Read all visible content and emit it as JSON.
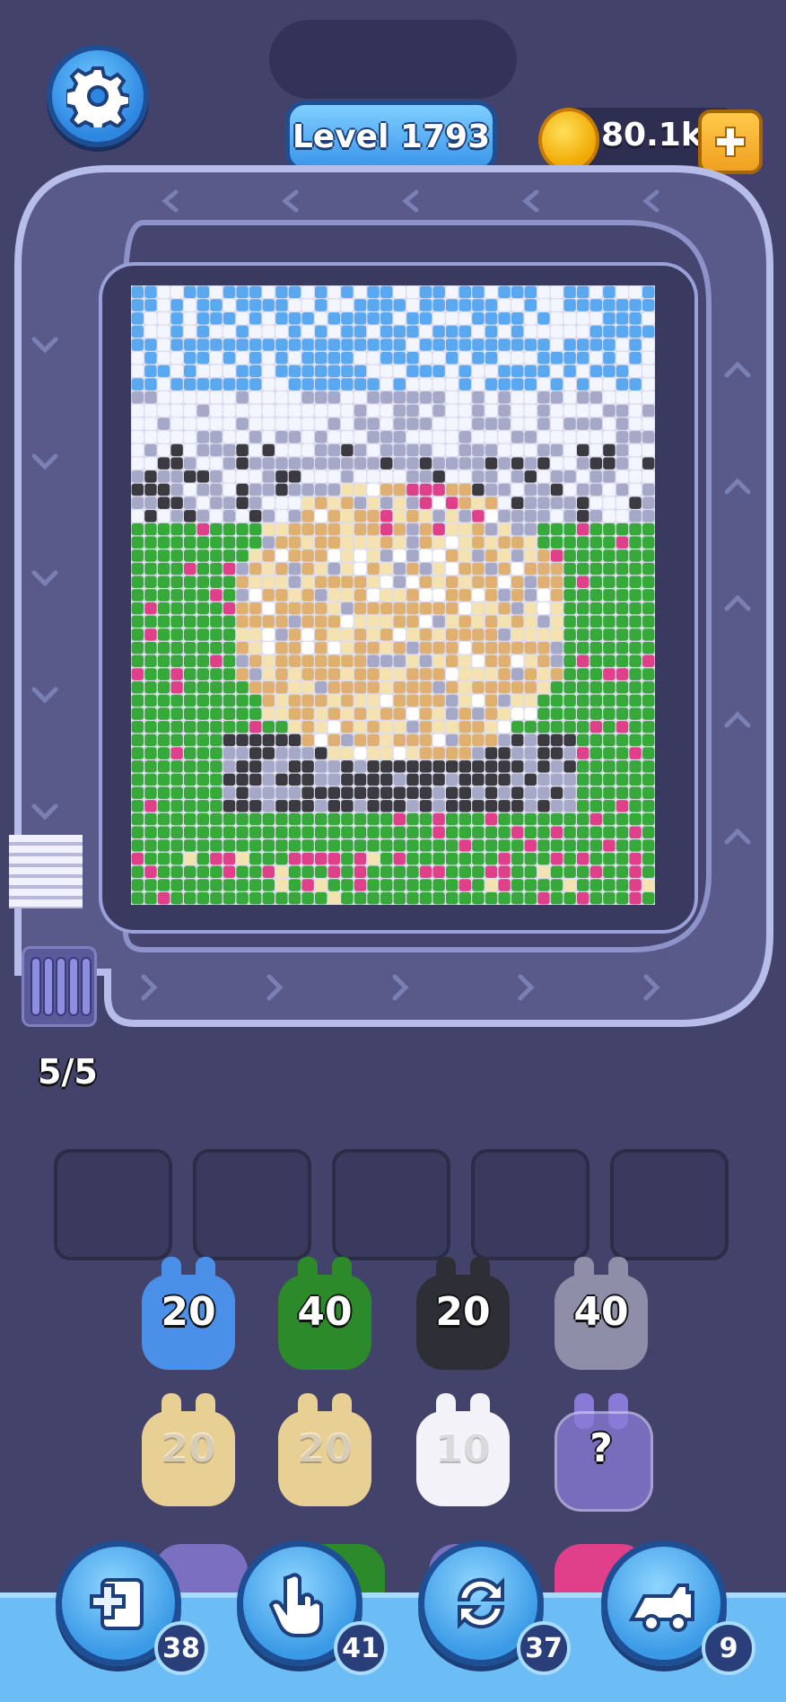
{
  "header": {
    "level_label": "Level 1793",
    "coins": "80.1k"
  },
  "queue": {
    "counter": "5/5"
  },
  "slots": [
    {},
    {},
    {},
    {},
    {}
  ],
  "colors": {
    "sky": "#5aa8f0",
    "cloud": "#f4f6ff",
    "mountain": "#a6a8c8",
    "dark": "#3a3a40",
    "grass": "#37a83a",
    "cream": "#f4e3b0",
    "tan": "#e0b070",
    "white": "#ffffff",
    "pink": "#e0408a",
    "blue_piece": "#4a8fe8",
    "green_piece": "#2c8a2a",
    "black_piece": "#2e2e36",
    "gray_piece": "#8e8ea8",
    "mystery_piece": "#8a7ad8"
  },
  "pieces": [
    {
      "name": "blue-piece",
      "color": "#4a8fe8",
      "count": "20"
    },
    {
      "name": "green-piece",
      "color": "#2c8a2a",
      "count": "40"
    },
    {
      "name": "black-piece",
      "color": "#2e2e36",
      "count": "20"
    },
    {
      "name": "gray-piece",
      "color": "#8e8ea8",
      "count": "40"
    },
    {
      "name": "cream-piece",
      "color": "#e8cf94",
      "count": "20"
    },
    {
      "name": "cream-piece",
      "color": "#e8cf94",
      "count": "20"
    },
    {
      "name": "white-piece",
      "color": "#f2f2f8",
      "count": "10"
    },
    {
      "name": "mystery-piece",
      "color": "#8a7ad8",
      "count": "?"
    }
  ],
  "tools": [
    {
      "name": "add-slot-tool",
      "icon": "add-slot-icon",
      "count": "38"
    },
    {
      "name": "pick-tool",
      "icon": "hand-pointer-icon",
      "count": "41"
    },
    {
      "name": "shuffle-tool",
      "icon": "shuffle-icon",
      "count": "37"
    },
    {
      "name": "train-tool",
      "icon": "train-icon",
      "count": "9"
    }
  ]
}
